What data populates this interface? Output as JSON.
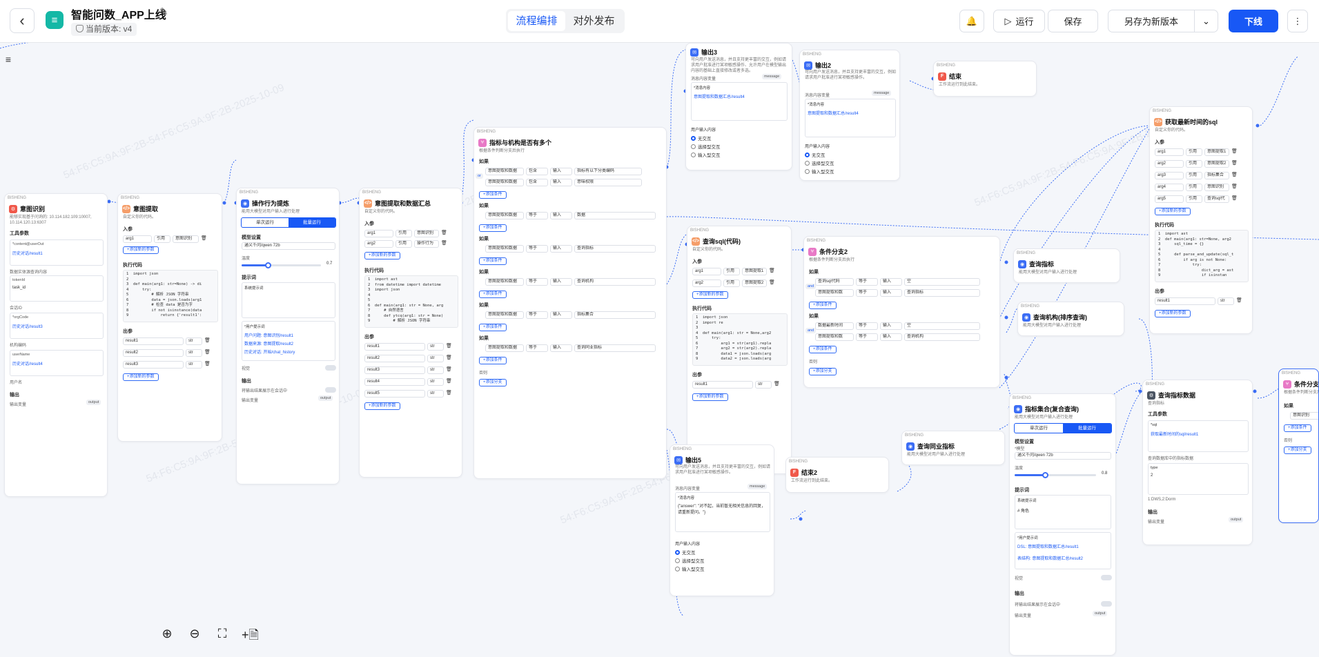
{
  "header": {
    "back": "‹",
    "title": "智能问数_APP上线",
    "version": "当前版本: v4",
    "tabs": [
      "流程编排",
      "对外发布"
    ],
    "run": "运行",
    "save": "保存",
    "save_as": "另存为新版本",
    "publish": "下线"
  },
  "canvas": {
    "zoom_in": "⊕",
    "zoom_out": "⊖",
    "fit": "⛶",
    "add_note": "+🗎",
    "watermark": "54:F6:C5:9A:9F:2B-54:F6:C5:9A:9F:2B-2025-10-09"
  },
  "common": {
    "tag": "BISHENG",
    "add_param": "+添加新的参数",
    "add_cond": "+添加条件",
    "add_branch": "+添加分支",
    "code": "执行代码",
    "input": "入参",
    "output": "出参",
    "cite": "引用",
    "else": "否则",
    "text_input": "输入",
    "eq": "等于",
    "contains": "包含",
    "str": "str",
    "and": "and"
  },
  "n_intent": {
    "title": "意图识别",
    "desc": "能够实现基于问询的: 10.114.182.109:10007,",
    "desc2": "10.114.120.13:6307",
    "tool": "工具参数",
    "f1": "*content@userOut",
    "v1": "历史对话/result1",
    "l2": "数据实体源查询内容",
    "f2": "tokenId",
    "v2": "task_id",
    "l3": "会话ID",
    "f3": "*orgCode",
    "v3": "历史对话/result3",
    "l4": "机构编码",
    "f4": "userName",
    "v4": "历史对话/result4",
    "l5": "用户名",
    "out": "输出",
    "outvar": "输出变量",
    "outbtn": "output"
  },
  "n_extract": {
    "title": "意图提取",
    "desc": "自定义你的代码。",
    "arg": "arg1",
    "argv": "意图识别",
    "out": [
      "result1",
      "result2",
      "result3"
    ],
    "code": "1  import json\n2\n3  def main(arg1: str=None) -> di\n4      try:\n5          # 解析 JSON 字符串\n6          data = json.loads(arg1\n7          # 检查 data 是否为字\n8          if not isinstance(data\n9              return {'result1':"
  },
  "n_behavior": {
    "title": "操作行为提炼",
    "desc": "能用大模型对用户输入进行处理",
    "seg": [
      "单次运行",
      "批量运行"
    ],
    "model": "模型设置",
    "modelname": "通义千问/qwen 72b",
    "temp": "温度",
    "temp_val": "0.7",
    "prompt": "提示词",
    "sys": "系统提示词",
    "user": "*用户提示词",
    "u1": "用户问题: 意图识别/result1",
    "u2": "数据来源: 意图提取/result2",
    "u3": "历史对话: 开始/chat_history",
    "vision": "视觉",
    "out": "输出",
    "outmsg": "将输出结果展示在会话中",
    "outvar": "输出变量",
    "outbtn": "output"
  },
  "n_summary": {
    "title": "意图提取和数据汇总",
    "desc": "自定义你的代码。",
    "args": [
      "arg1",
      "arg2"
    ],
    "argv": [
      "意图识别",
      "操作行为"
    ],
    "outs": [
      "result1",
      "result2",
      "result3",
      "result4",
      "result5"
    ],
    "code": "1  import ast\n2  from datetime import datetime\n3  import json\n4\n5\n6  def main(arg1: str = None, arg\n7      # 自然语言\n8      def ytcq(arg1: str = None)\n9          # 解析 JSON 字符串"
  },
  "n_branch1": {
    "title": "指标与机构是否有多个",
    "desc": "根据条件判断分支后执行",
    "if": "如果",
    "v1": "意图提取和数据",
    "v2": "指标有以下分类编码",
    "v3": "意味权限",
    "v4": "数据",
    "v5": "查询指标",
    "v6": "查询机构",
    "v7": "指标集合",
    "v8": "查询同业指标",
    "or": "or"
  },
  "n_out3": {
    "title": "输出3",
    "desc": "可向用户发送消息，并且支持更丰富的交互，例如请求用户批准进行某项敏感操作、允许用户在模型输出内容的基础上直接修改或者多选。",
    "msg": "消息内容变量",
    "msgbtn": "message",
    "f": "*消息内容",
    "v": "意图提取和数据汇总/result4",
    "ui": "用户输入内容",
    "r1": "无交互",
    "r2": "选择型交互",
    "r3": "输入型交互"
  },
  "n_out2": {
    "title": "输出2",
    "desc": "可向用户发送消息，并且支持更丰富的交互，例如请求用户批准进行某项敏感操作。",
    "msg": "消息内容变量",
    "msgbtn": "message",
    "f": "*消息内容",
    "v": "意图提取和数据汇总/result4",
    "ui": "用户输入内容",
    "r1": "无交互",
    "r2": "选择型交互",
    "r3": "输入型交互"
  },
  "n_end": {
    "title": "结束",
    "desc": "工作流运行到此结束。"
  },
  "n_sql": {
    "title": "获取最新时间的sql",
    "desc": "自定义你的代码。",
    "args": [
      "arg1",
      "arg2",
      "arg3",
      "arg4",
      "arg5"
    ],
    "argv": [
      "意图提取1",
      "意图提取2",
      "指标集合",
      "意图识别",
      "查询sql代"
    ],
    "code": "1  import ast\n2  def main(arg1: str=None, arg2\n3      sql_time = {}\n4\n5      def parse_and_update(sql_t\n6          if arg is not None:\n7              try:\n8                  dict_arg = ast\n9                  if isinstan",
    "out": "result1"
  },
  "n_querysql": {
    "title": "查询sql(代码)",
    "desc": "自定义你的代码。",
    "args": [
      "arg1",
      "arg2"
    ],
    "argv": [
      "意图提取1",
      "意图提取2"
    ],
    "code": "1  import json\n2  import re\n3\n4  def main(arg1: str = None,arg2\n5      try:\n6          arg1 = str(arg1).repla\n7          arg2 = str(arg2).repla\n8          data1 = json.loads(arg\n9          data2 = json.loads(arg",
    "out": "result1"
  },
  "n_branch2": {
    "title": "条件分支2",
    "desc": "根据条件判断分支后执行",
    "c1": "查询sql代码",
    "c2": "意图提取和数",
    "c3": "数据最新时间",
    "v1": "空",
    "v2": "查询指标",
    "v3": "空",
    "v4": "查询机构"
  },
  "n_qind": {
    "title": "查询指标",
    "desc": "能用大模型对用户输入进行处理"
  },
  "n_qorg": {
    "title": "查询机构(排序查询)",
    "desc": "能用大模型对用户输入进行处理"
  },
  "n_combo": {
    "title": "指标集合(复合查询)",
    "desc": "能用大模型对用户输入进行处理",
    "seg": [
      "单次运行",
      "批量运行"
    ],
    "model": "模型设置",
    "modelname": "通义千问/qwen 72b",
    "temp": "温度",
    "temp_val": "0.8",
    "prompt": "提示词",
    "sys": "系统提示词",
    "sysv": "# 角色",
    "user": "*用户提示词",
    "u1": "DSL: 意图提取和数据汇总/result1",
    "u2": "表结构: 意图提取和数据汇总/result2",
    "vision": "视觉",
    "out": "输出",
    "outmsg": "将输出结果展示在会话中",
    "outvar": "输出变量",
    "outbtn": "output"
  },
  "n_peer": {
    "title": "查询同业指标",
    "desc": "能用大模型对用户输入进行处理"
  },
  "n_out5": {
    "title": "输出5",
    "desc": "可向用户发送消息，并且支持更丰富的交互，例如请求用户批准进行某项敏感操作。",
    "msg": "消息内容变量",
    "msgbtn": "message",
    "f": "*消息内容",
    "v": "{\"answer\": \"对不起，当前暂无相关信息的回复，请重新提问。\"}",
    "ui": "用户输入内容",
    "r1": "无交互",
    "r2": "选择型交互",
    "r3": "输入型交互"
  },
  "n_end2": {
    "title": "结束2",
    "desc": "工作流运行到此结束。"
  },
  "n_qdata": {
    "title": "查询指标数据",
    "desc": "查询指标",
    "tool": "工具参数",
    "f1": "*sql",
    "v1": "获取最新时间的sql/result1",
    "l1": "查询数据库中的指标数据",
    "f2": "type",
    "v2": "2",
    "l2": "1:DWS,2:Dorm",
    "out": "输出",
    "outvar": "输出变量",
    "outbtn": "output"
  },
  "n_branch3": {
    "title": "条件分支",
    "desc": "根据条件判断分支后执行",
    "v1": "意图识别"
  }
}
